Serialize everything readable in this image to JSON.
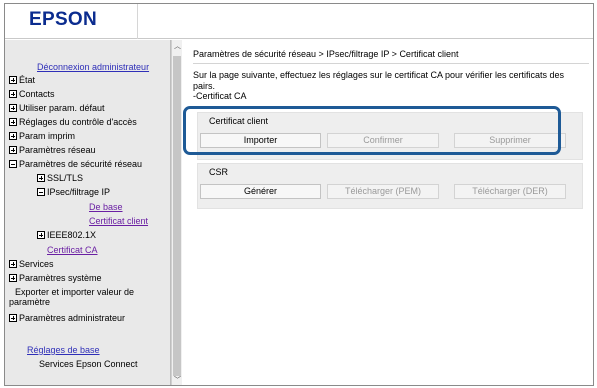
{
  "header": {
    "logo": "EPSON"
  },
  "sidebar": {
    "logout": "Déconnexion administrateur",
    "items": [
      {
        "label": "État",
        "expandable": true,
        "expanded": false
      },
      {
        "label": "Contacts",
        "expandable": true,
        "expanded": false
      },
      {
        "label": "Utiliser param. défaut",
        "expandable": true,
        "expanded": false
      },
      {
        "label": "Réglages du contrôle d'accès",
        "expandable": true,
        "expanded": false
      },
      {
        "label": "Param imprim",
        "expandable": true,
        "expanded": false
      },
      {
        "label": "Paramètres réseau",
        "expandable": true,
        "expanded": false
      },
      {
        "label": "Paramètres de sécurité réseau",
        "expandable": true,
        "expanded": true
      }
    ],
    "security_children": {
      "ssl": "SSL/TLS",
      "ipsec": "IPsec/filtrage IP",
      "ipsec_basic": "De base",
      "ipsec_client_cert": "Certificat client",
      "ieee": "IEEE802.1X",
      "ca_cert": "Certificat CA"
    },
    "items_after": [
      {
        "label": "Services",
        "expandable": true
      },
      {
        "label": "Paramètres système",
        "expandable": true
      }
    ],
    "export_line1": "Exporter et importer valeur de",
    "export_line2": "paramètre",
    "admin_settings": "Paramètres administrateur",
    "basic_settings": "Réglages de base",
    "epson_connect": "Services Epson Connect"
  },
  "main": {
    "breadcrumb": "Paramètres de sécurité réseau > IPsec/filtrage IP > Certificat client",
    "description_line1": "Sur la page suivante, effectuez les réglages sur le certificat CA pour vérifier les certificats des",
    "description_line2": "pairs.",
    "description_line3": "-Certificat CA",
    "client_cert_section": {
      "title": "Certificat client",
      "import_label": "Importer",
      "confirm_label": "Confirmer",
      "delete_label": "Supprimer"
    },
    "csr_section": {
      "title": "CSR",
      "generate_label": "Générer",
      "download_pem_label": "Télécharger (PEM)",
      "download_der_label": "Télécharger (DER)"
    }
  },
  "colors": {
    "brand": "#0b2c8f",
    "link": "#2f2fb8",
    "visited_link": "#6a1fa3",
    "highlight_border": "#1e5a96",
    "sidebar_bg": "#e9e9e9",
    "panel_bg": "#eeeeee"
  }
}
